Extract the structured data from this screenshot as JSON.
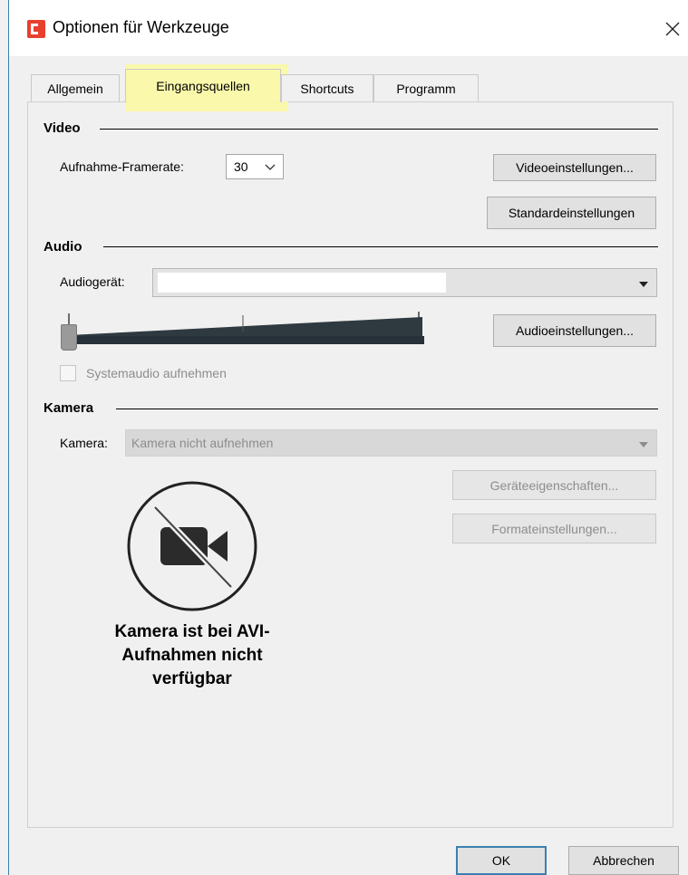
{
  "window": {
    "title": "Optionen für Werkzeuge",
    "close_glyph": "✕"
  },
  "tabs": [
    {
      "label": "Allgemein",
      "active": false
    },
    {
      "label": "Eingangsquellen",
      "active": true
    },
    {
      "label": "Shortcuts",
      "active": false
    },
    {
      "label": "Programm",
      "active": false
    }
  ],
  "video": {
    "title": "Video",
    "framerate_label": "Aufnahme-Framerate:",
    "framerate_value": "30",
    "video_settings_button": "Videoeinstellungen...",
    "default_settings_button": "Standardeinstellungen"
  },
  "audio": {
    "title": "Audio",
    "device_label": "Audiogerät:",
    "device_value": "",
    "volume_level": 0.0,
    "audio_settings_button": "Audioeinstellungen...",
    "system_audio_label": "Systemaudio aufnehmen",
    "system_audio_checked": false
  },
  "camera": {
    "title": "Kamera",
    "camera_label": "Kamera:",
    "camera_value": "Kamera nicht aufnehmen",
    "device_properties_button": "Geräteeigenschaften...",
    "format_settings_button": "Formateinstellungen...",
    "unavailable_line1": "Kamera ist bei AVI-",
    "unavailable_line2": "Aufnahmen nicht",
    "unavailable_line3": "verfügbar",
    "icon": "camera-off-icon"
  },
  "footer": {
    "ok_button": "OK",
    "cancel_button": "Abbrechen"
  },
  "colors": {
    "accent_icon": "#e8402e",
    "tab_highlight": "#fbf8a3",
    "window_border": "#3c7fb1"
  }
}
